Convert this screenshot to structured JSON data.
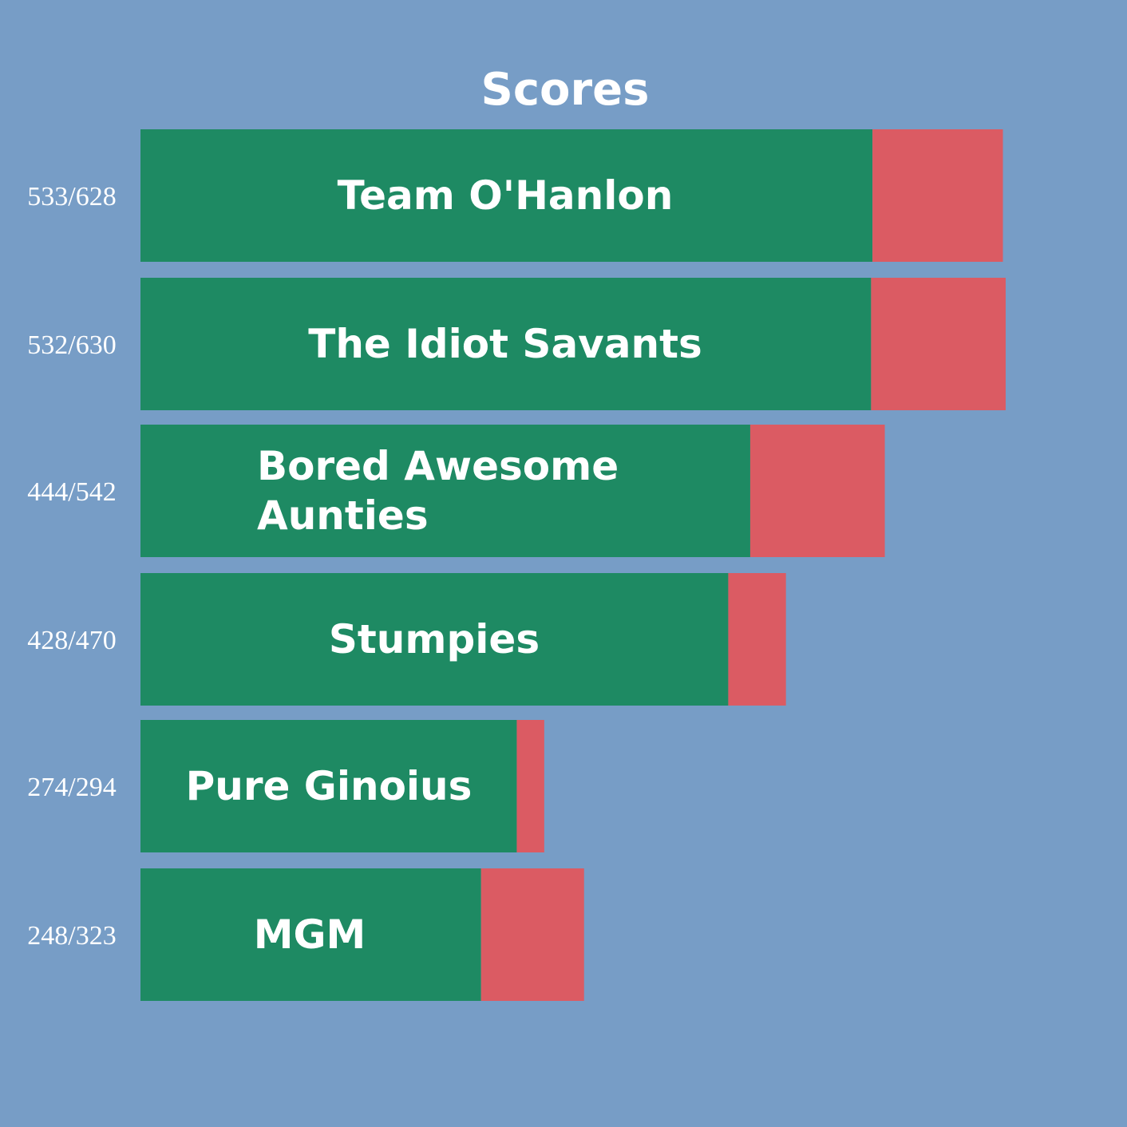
{
  "chart_data": {
    "type": "bar",
    "orientation": "horizontal",
    "stacked": true,
    "title": "Scores",
    "teams": [
      {
        "name": "Team O'Hanlon",
        "score_label": "533/628",
        "correct": 533,
        "total": 628
      },
      {
        "name": "The Idiot Savants",
        "score_label": "532/630",
        "correct": 532,
        "total": 630
      },
      {
        "name": "Bored Awesome Aunties",
        "name_lines": [
          "Bored Awesome",
          "Aunties"
        ],
        "score_label": "444/542",
        "correct": 444,
        "total": 542
      },
      {
        "name": "Stumpies",
        "score_label": "428/470",
        "correct": 428,
        "total": 470
      },
      {
        "name": "Pure Ginoius",
        "score_label": "274/294",
        "correct": 274,
        "total": 294
      },
      {
        "name": "MGM",
        "score_label": "248/323",
        "correct": 248,
        "total": 323
      }
    ],
    "xlim": [
      0,
      630
    ],
    "grid": false,
    "legend": "none"
  },
  "colors": {
    "background": "#779dc6",
    "correct": "#1e8a63",
    "incorrect": "#db5b63",
    "text": "#ffffff"
  }
}
